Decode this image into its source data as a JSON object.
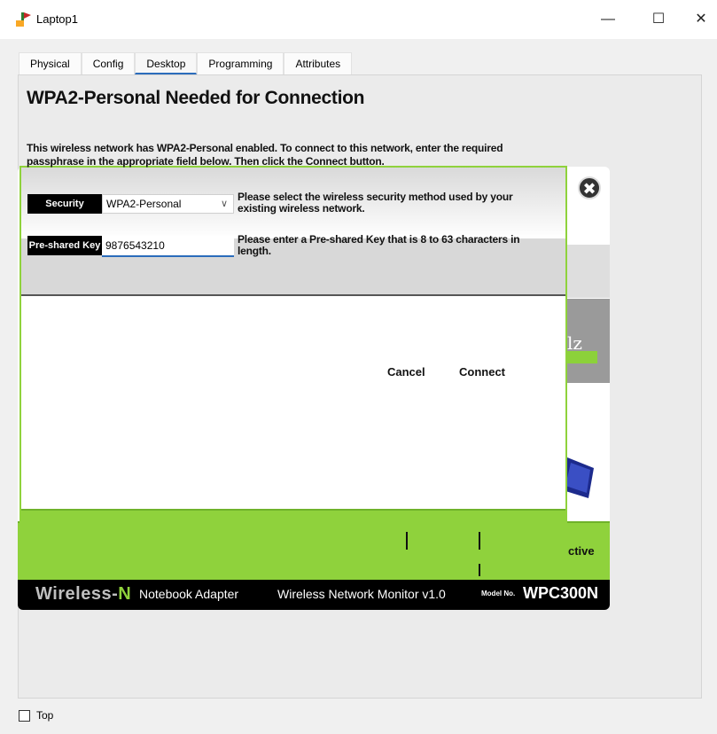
{
  "window": {
    "title": "Laptop1",
    "minimize_glyph": "—",
    "maximize_glyph": "☐",
    "close_glyph": "✕"
  },
  "tabs": [
    {
      "label": "Physical"
    },
    {
      "label": "Config"
    },
    {
      "label": "Desktop"
    },
    {
      "label": "Programming"
    },
    {
      "label": "Attributes"
    }
  ],
  "active_tab": "Desktop",
  "background_app": {
    "partial_text_lz": "lz",
    "partial_text_active": "ctive",
    "brand_prefix": "Wireless-",
    "brand_suffix": "N",
    "product": "Notebook Adapter",
    "monitor_title": "Wireless Network Monitor  v1.0",
    "model_label": "Model No.",
    "model_value": "WPC300N",
    "close_glyph": "✖"
  },
  "dialog": {
    "title": "WPA2-Personal Needed for Connection",
    "description_part1": "This wireless network has WPA2-Personal enabled. To connect to this network, enter the required passphrase in the appropriate field below. Then click the ",
    "description_emphasis": "Connect",
    "description_part2": " button.",
    "security_label": "Security",
    "security_value": "WPA2-Personal",
    "security_help": "Please select the wireless security method used by your existing wireless network.",
    "psk_label": "Pre-shared Key",
    "psk_value": "9876543210",
    "psk_help": "Please enter a Pre-shared Key that is 8 to 63 characters in length.",
    "cancel_label": "Cancel",
    "connect_label": "Connect"
  },
  "footer": {
    "top_checkbox_label": "Top",
    "top_checked": false
  },
  "colors": {
    "accent_green": "#8fd23c",
    "tab_underline": "#2b6cbb"
  }
}
